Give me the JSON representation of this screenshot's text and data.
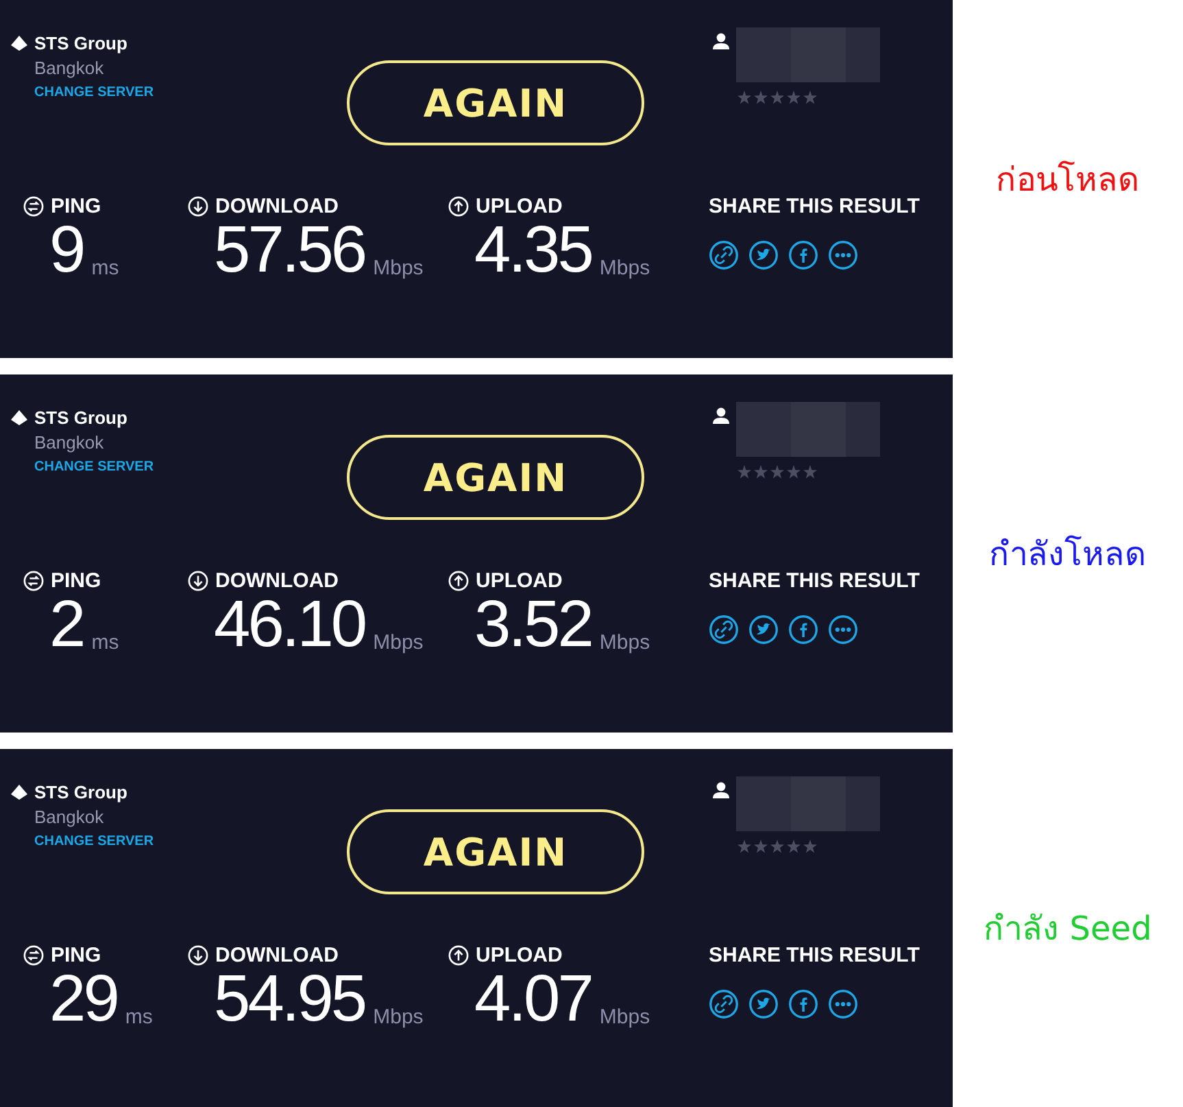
{
  "panels": [
    {
      "server": {
        "name": "STS Group",
        "location": "Bangkok",
        "change_label": "CHANGE SERVER"
      },
      "again_label": "AGAIN",
      "stars": 0,
      "metrics": [
        {
          "kind": "ping",
          "label": "PING",
          "value": "9",
          "unit": "ms"
        },
        {
          "kind": "download",
          "label": "DOWNLOAD",
          "value": "57.56",
          "unit": "Mbps"
        },
        {
          "kind": "upload",
          "label": "UPLOAD",
          "value": "4.35",
          "unit": "Mbps"
        }
      ],
      "share_label": "SHARE THIS RESULT",
      "caption": {
        "text": "ก่อนโหลด",
        "color": "#ee1111"
      }
    },
    {
      "server": {
        "name": "STS Group",
        "location": "Bangkok",
        "change_label": "CHANGE SERVER"
      },
      "again_label": "AGAIN",
      "stars": 0,
      "metrics": [
        {
          "kind": "ping",
          "label": "PING",
          "value": "2",
          "unit": "ms"
        },
        {
          "kind": "download",
          "label": "DOWNLOAD",
          "value": "46.10",
          "unit": "Mbps"
        },
        {
          "kind": "upload",
          "label": "UPLOAD",
          "value": "3.52",
          "unit": "Mbps"
        }
      ],
      "share_label": "SHARE THIS RESULT",
      "caption": {
        "text": "กำลังโหลด",
        "color": "#1a1aee"
      }
    },
    {
      "server": {
        "name": "STS Group",
        "location": "Bangkok",
        "change_label": "CHANGE SERVER"
      },
      "again_label": "AGAIN",
      "stars": 0,
      "metrics": [
        {
          "kind": "ping",
          "label": "PING",
          "value": "29",
          "unit": "ms"
        },
        {
          "kind": "download",
          "label": "DOWNLOAD",
          "value": "54.95",
          "unit": "Mbps"
        },
        {
          "kind": "upload",
          "label": "UPLOAD",
          "value": "4.07",
          "unit": "Mbps"
        }
      ],
      "share_label": "SHARE THIS RESULT",
      "caption": {
        "text": "กำลัง Seed",
        "color": "#22cc33"
      }
    }
  ]
}
